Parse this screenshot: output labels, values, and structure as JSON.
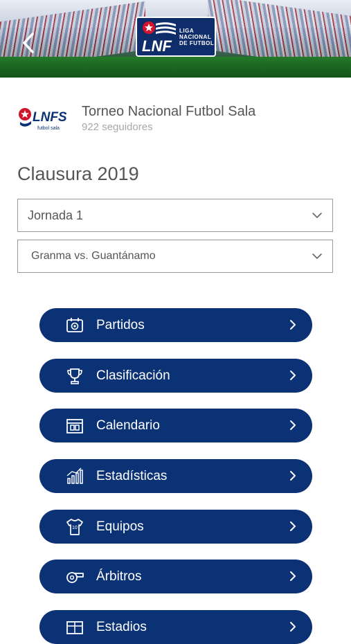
{
  "header": {
    "back_icon": "chevron-left-icon",
    "logo": {
      "mark": "LNF",
      "line1": "LIGA",
      "line2": "NACIONAL",
      "line3": "DE FUTBOL"
    }
  },
  "league": {
    "logo_mark": "LNFS",
    "logo_sub": "futbol sala",
    "name": "Torneo Nacional Futbol Sala",
    "followers": "922 seguidores"
  },
  "season": {
    "title": "Clausura 2019"
  },
  "filters": {
    "round": {
      "selected": "Jornada 1"
    },
    "match": {
      "selected": "Granma vs. Guantánamo"
    }
  },
  "menu": [
    {
      "label": "Partidos",
      "icon": "match-icon"
    },
    {
      "label": "Clasificación",
      "icon": "trophy-icon"
    },
    {
      "label": "Calendario",
      "icon": "calendar-icon"
    },
    {
      "label": "Estadísticas",
      "icon": "stats-icon"
    },
    {
      "label": "Equipos",
      "icon": "jersey-icon"
    },
    {
      "label": "Árbitros",
      "icon": "whistle-icon"
    },
    {
      "label": "Estadios",
      "icon": "stadium-icon"
    }
  ],
  "colors": {
    "primary": "#0c3276",
    "brand_red": "#d0142b",
    "text": "#555555",
    "muted": "#a8a8a8"
  }
}
